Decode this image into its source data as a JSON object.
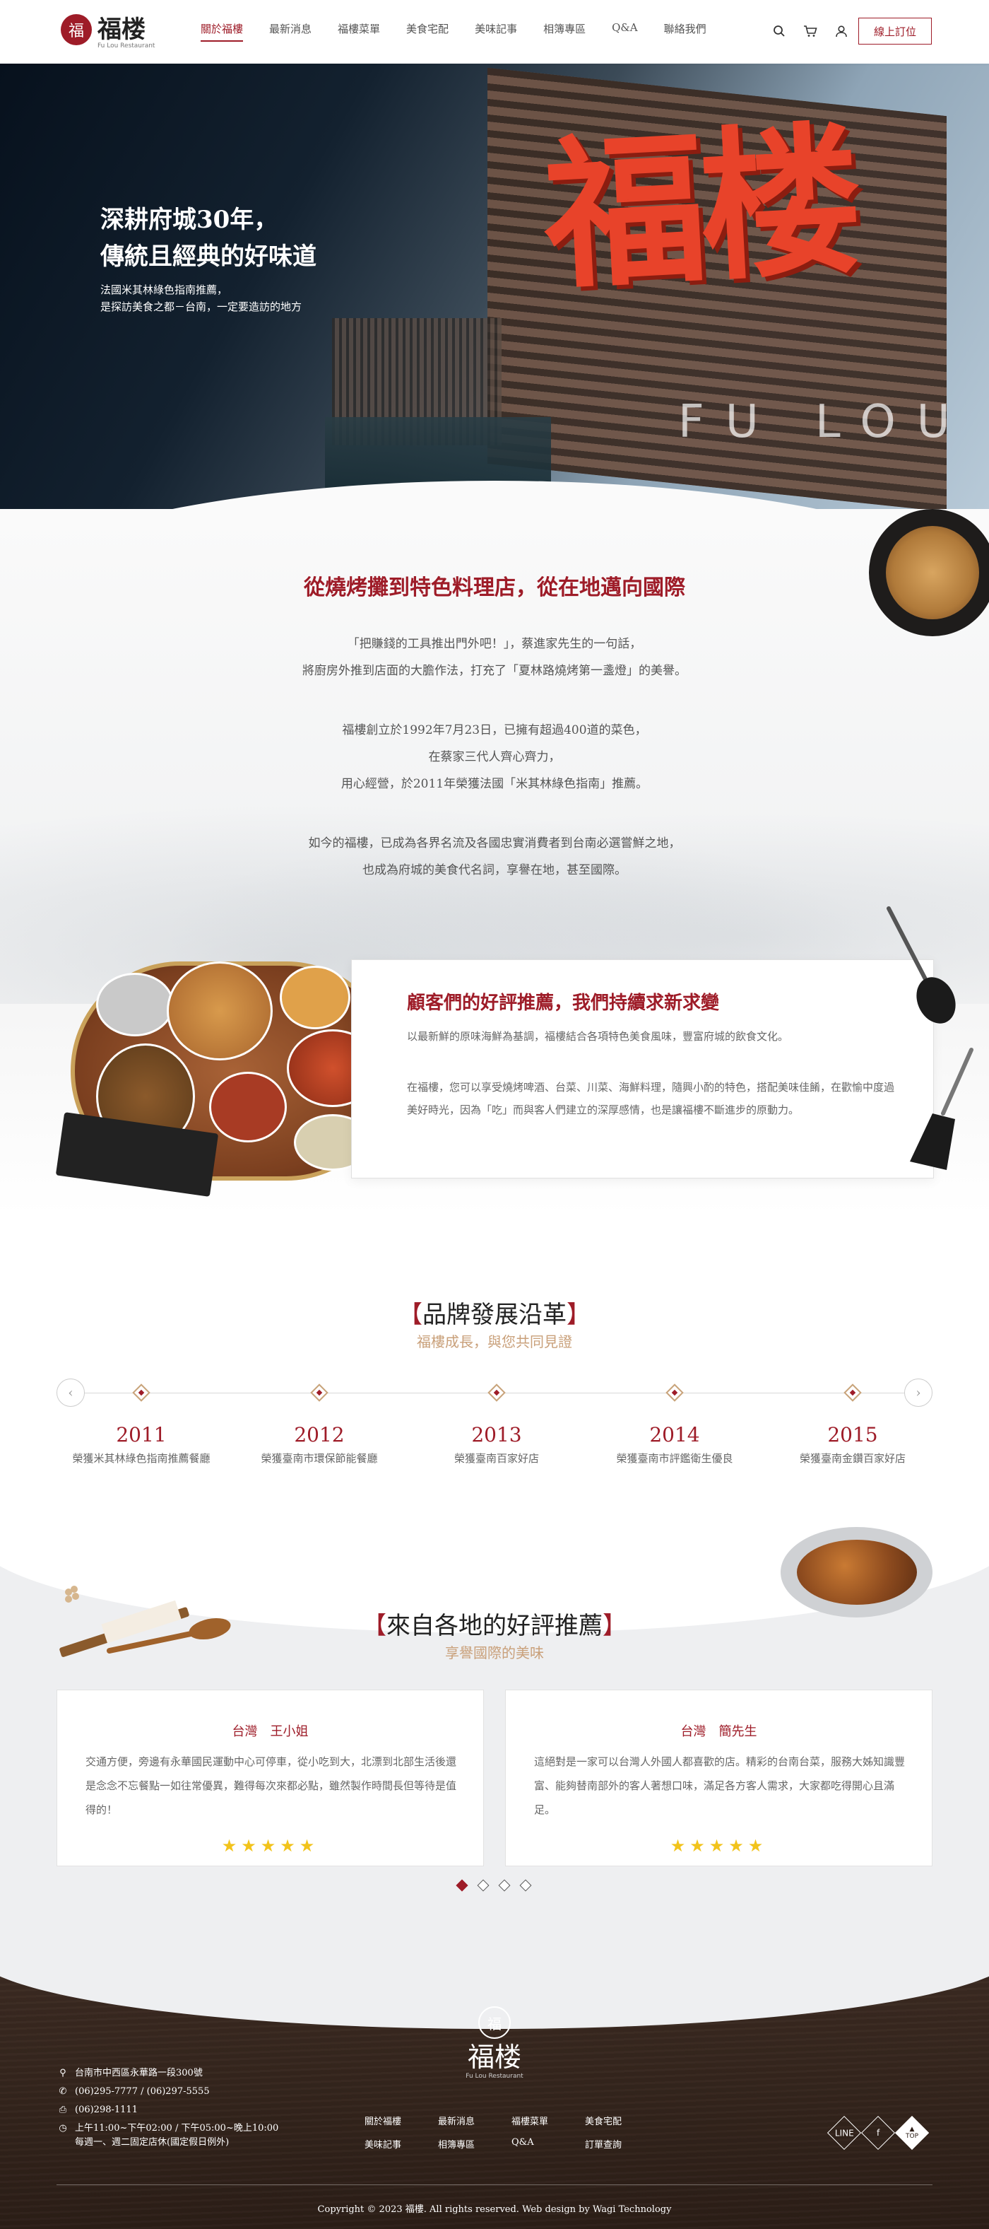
{
  "brand": {
    "name": "福楼",
    "sub": "Fu Lou Restaurant",
    "mark": "福"
  },
  "nav": {
    "items": [
      "關於福樓",
      "最新消息",
      "福樓菜單",
      "美食宅配",
      "美味記事",
      "相簿專區",
      "Q&A",
      "聯絡我們"
    ],
    "active_index": 0,
    "reserve_label": "線上訂位"
  },
  "hero": {
    "title_line1": "深耕府城30年，",
    "title_line2": "傳統且經典的好味道",
    "sub_line1": "法國米其林綠色指南推薦，",
    "sub_line2": "是探訪美食之都－台南，一定要造訪的地方",
    "sign_text": "福楼",
    "sign_latin": "FU LOU"
  },
  "intro": {
    "title": "從燒烤攤到特色料理店，從在地邁向國際",
    "p1": [
      "「把賺錢的工具推出門外吧！」，蔡進家先生的一句話，",
      "將廚房外推到店面的大膽作法，打充了「夏林路燒烤第一盞燈」的美譽。"
    ],
    "p2": [
      "福樓創立於1992年7月23日，已擁有超過400道的菜色，",
      "在蔡家三代人齊心齊力，",
      "用心經營，於2011年榮獲法國「米其林綠色指南」推薦。"
    ],
    "p3": [
      "如今的福樓，已成為各界名流及各國忠實消費者到台南必選嘗鮮之地，",
      "也成為府城的美食代名詞，享譽在地，甚至國際。"
    ]
  },
  "recommend": {
    "title": "顧客們的好評推薦，我們持續求新求變",
    "text1": "以最新鮮的原味海鮮為基調，福樓結合各項特色美食風味，豐富府城的飲食文化。",
    "text2": "在福樓，您可以享受燒烤啤酒、台菜、川菜、海鮮料理，隨興小酌的特色，搭配美味佳餚，在歡愉中度過美好時光，因為「吃」而與客人們建立的深厚感情，也是讓福樓不斷進步的原動力。"
  },
  "timeline": {
    "title": "品牌發展沿革",
    "bracket_open": "【",
    "bracket_close": "】",
    "sub": "福樓成長，與您共同見證",
    "items": [
      {
        "year": "2011",
        "desc": "榮獲米其林綠色指南推薦餐廳"
      },
      {
        "year": "2012",
        "desc": "榮獲臺南市環保節能餐廳"
      },
      {
        "year": "2013",
        "desc": "榮獲臺南百家好店"
      },
      {
        "year": "2014",
        "desc": "榮獲臺南市評鑑衛生優良"
      },
      {
        "year": "2015",
        "desc": "榮獲臺南金鑽百家好店"
      }
    ],
    "prev": "‹",
    "next": "›"
  },
  "reviews": {
    "title": "來自各地的好評推薦",
    "sub": "享譽國際的美味",
    "items": [
      {
        "name": "台灣　王小姐",
        "text": "交通方便，旁邊有永華國民運動中心可停車，從小吃到大，北漂到北部生活後還是念念不忘餐點一如往常優異，難得每次來都必點，雖然製作時間長但等待是值得的！",
        "stars": 5
      },
      {
        "name": "台灣　簡先生",
        "text": "這絕對是一家可以台灣人外國人都喜歡的店。精彩的台南台菜，服務大姊知識豐富、能夠替南部外的客人著想口味，滿足各方客人需求，大家都吃得開心且滿足。",
        "stars": 5
      }
    ],
    "page_count": 4,
    "page_active": 0
  },
  "footer": {
    "address": "台南市中西區永華路一段300號",
    "phone": "(06)295-7777 / (06)297-5555",
    "fax": "(06)298-1111",
    "hours_line1": "上午11:00~下午02:00 / 下午05:00~晚上10:00",
    "hours_line2": "每週一、週二固定店休(國定假日例外)",
    "links": [
      "關於福樓",
      "最新消息",
      "福樓菜單",
      "美食宅配",
      "美味記事",
      "相簿專區",
      "Q&A",
      "訂單查詢"
    ],
    "social": {
      "line": "LINE",
      "facebook": "f",
      "top_arrow": "▲",
      "top": "TOP"
    },
    "copyright": "Copyright © 2023 福樓. All rights reserved. Web design by Wagi Technology"
  },
  "colors": {
    "brand_red": "#9e1c28",
    "gold": "#c9a07a",
    "star": "#f2c31b",
    "footer_wood": "#3c2b22"
  },
  "icons": {
    "search": "search-icon",
    "cart": "cart-icon",
    "user": "user-icon",
    "pin": "location-icon",
    "phone": "phone-icon",
    "fax": "fax-icon",
    "clock": "clock-icon"
  }
}
